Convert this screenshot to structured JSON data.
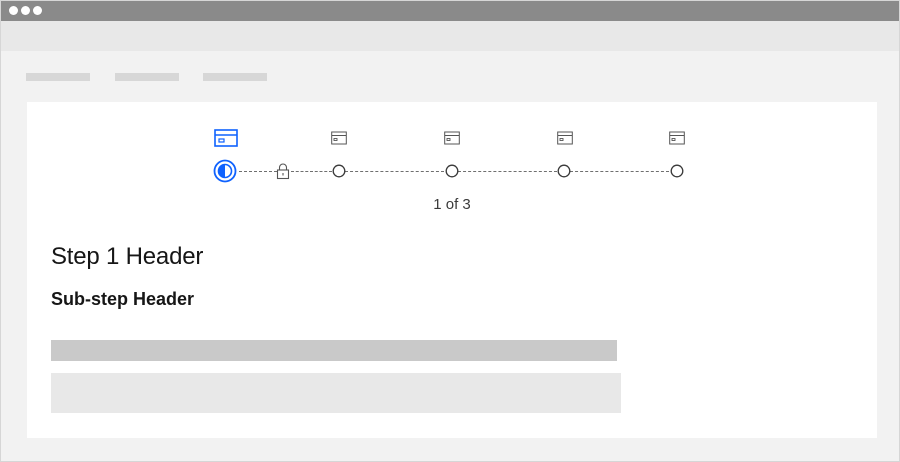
{
  "window": {
    "controls": [
      "window-dot-icon",
      "window-dot-icon",
      "window-dot-icon"
    ]
  },
  "breadcrumb": {
    "items": [
      "breadcrumb-placeholder",
      "breadcrumb-placeholder",
      "breadcrumb-placeholder"
    ]
  },
  "progress": {
    "steps": [
      {
        "icon": "card-icon",
        "state": "current"
      },
      {
        "icon": "lock-icon",
        "state": "locked"
      },
      {
        "icon": "card-icon",
        "state": "incomplete"
      },
      {
        "icon": "card-icon",
        "state": "incomplete"
      },
      {
        "icon": "card-icon",
        "state": "incomplete"
      },
      {
        "icon": "card-icon",
        "state": "incomplete"
      }
    ],
    "counter": "1 of 3",
    "accent_color": "#0f62fe"
  },
  "content": {
    "step_header": "Step 1 Header",
    "substep_header": "Sub-step Header"
  }
}
